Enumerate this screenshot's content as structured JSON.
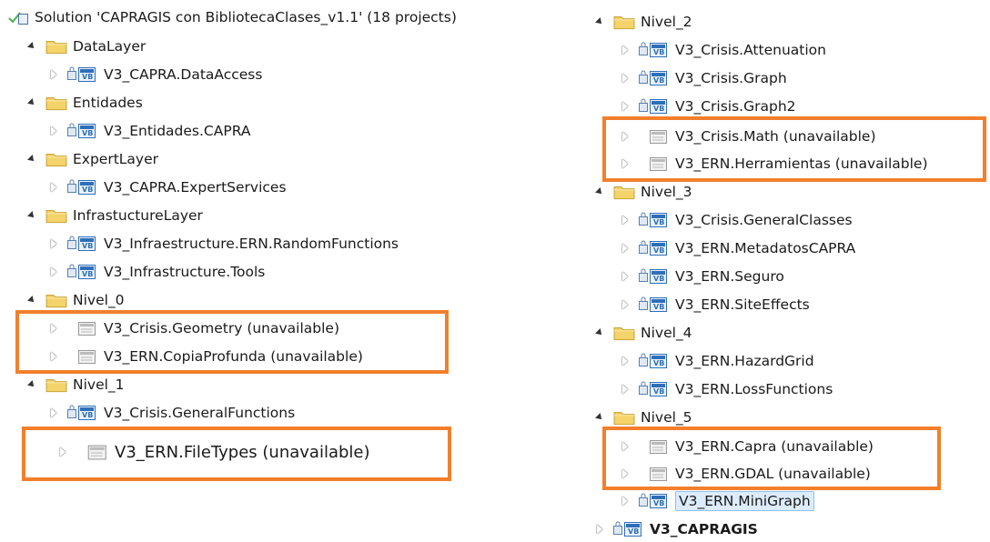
{
  "colors": {
    "highlight": "#f37f2b",
    "folder": "#f4d36a",
    "project": "#2f6fb8"
  },
  "solution": {
    "title": "Solution 'CAPRAGIS con BibliotecaClases_v1.1' (18 projects)",
    "icon": "solution-icon"
  },
  "left": {
    "datalayer": "DataLayer",
    "dataaccess": "V3_CAPRA.DataAccess",
    "entidades": "Entidades",
    "entidades_capra": "V3_Entidades.CAPRA",
    "expertlayer": "ExpertLayer",
    "expertservices": "V3_CAPRA.ExpertServices",
    "infralayer": "InfrastuctureLayer",
    "randomfunctions": "V3_Infraestructure.ERN.RandomFunctions",
    "tools": "V3_Infrastructure.Tools",
    "nivel0": "Nivel_0",
    "geometry": "V3_Crisis.Geometry (unavailable)",
    "copiaprofunda": "V3_ERN.CopiaProfunda (unavailable)",
    "nivel1": "Nivel_1",
    "generalfunctions": "V3_Crisis.GeneralFunctions",
    "filetypes": "V3_ERN.FileTypes (unavailable)"
  },
  "right": {
    "nivel2": "Nivel_2",
    "attenuation": "V3_Crisis.Attenuation",
    "graph": "V3_Crisis.Graph",
    "graph2": "V3_Crisis.Graph2",
    "math": "V3_Crisis.Math (unavailable)",
    "herramientas": "V3_ERN.Herramientas (unavailable)",
    "nivel3": "Nivel_3",
    "generalclasses": "V3_Crisis.GeneralClasses",
    "metadatos": "V3_ERN.MetadatosCAPRA",
    "seguro": "V3_ERN.Seguro",
    "siteeffects": "V3_ERN.SiteEffects",
    "nivel4": "Nivel_4",
    "hazardgrid": "V3_ERN.HazardGrid",
    "lossfunctions": "V3_ERN.LossFunctions",
    "nivel5": "Nivel_5",
    "capra": "V3_ERN.Capra (unavailable)",
    "gdal": "V3_ERN.GDAL (unavailable)",
    "minigraph": "V3_ERN.MiniGraph",
    "capragis": "V3_CAPRAGIS"
  }
}
